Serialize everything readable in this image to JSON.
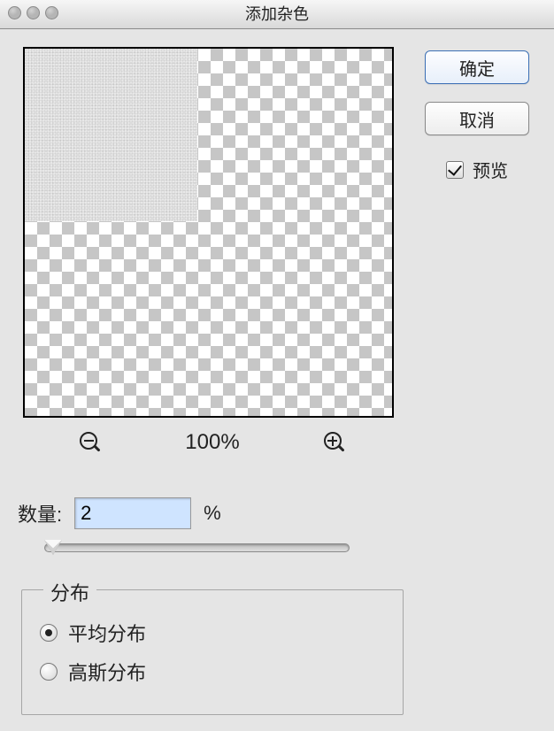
{
  "window": {
    "title": "添加杂色"
  },
  "buttons": {
    "ok": "确定",
    "cancel": "取消"
  },
  "preview_checkbox": {
    "label": "预览",
    "checked": true
  },
  "zoom": {
    "level": "100%"
  },
  "amount": {
    "label": "数量:",
    "value": "2",
    "unit": "%"
  },
  "distribution": {
    "legend": "分布",
    "uniform": "平均分布",
    "gaussian": "高斯分布",
    "selected": "uniform"
  }
}
